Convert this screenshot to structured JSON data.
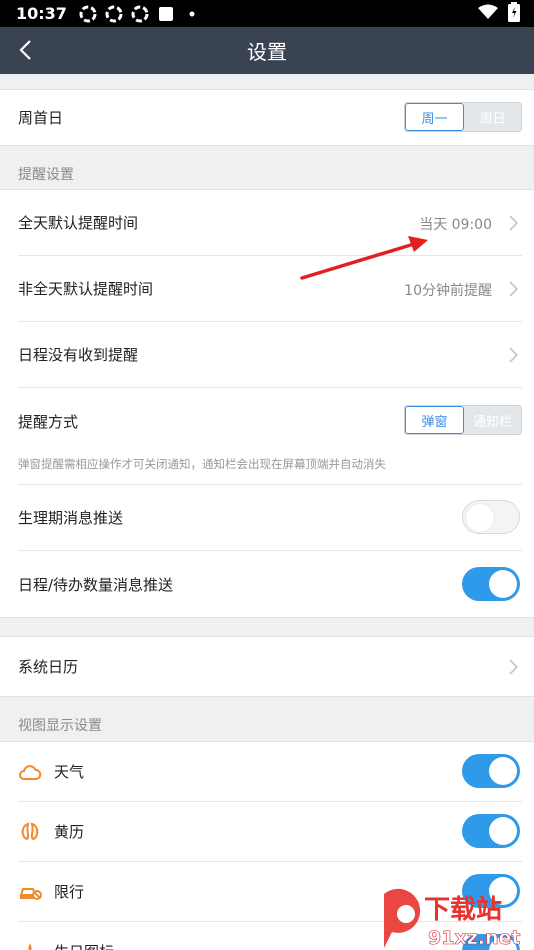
{
  "status_bar": {
    "time": "10:37"
  },
  "title_bar": {
    "title": "设置"
  },
  "week_start": {
    "label": "周首日",
    "options": [
      "周一",
      "周日"
    ],
    "selected": "周一"
  },
  "reminder_section": {
    "header": "提醒设置",
    "all_day_label": "全天默认提醒时间",
    "all_day_value": "当天 09:00",
    "non_all_day_label": "非全天默认提醒时间",
    "non_all_day_value": "10分钟前提醒",
    "not_received_label": "日程没有收到提醒",
    "method_label": "提醒方式",
    "method_options": [
      "弹窗",
      "通知栏"
    ],
    "method_selected": "弹窗",
    "method_note": "弹窗提醒需相应操作才可关闭通知，通知栏会出现在屏幕顶端并自动消失",
    "period_push_label": "生理期消息推送",
    "period_push_on": false,
    "count_push_label": "日程/待办数量消息推送",
    "count_push_on": true
  },
  "system_calendar": {
    "label": "系统日历"
  },
  "view_section": {
    "header": "视图显示设置",
    "items": [
      {
        "label": "天气",
        "icon": "cloud-icon",
        "on": true
      },
      {
        "label": "黄历",
        "icon": "almanac-icon",
        "on": true
      },
      {
        "label": "限行",
        "icon": "car-icon",
        "on": true
      },
      {
        "label": "生日图标",
        "icon": "birthday-icon",
        "on": true
      }
    ]
  },
  "colors": {
    "accent": "#2f9ae9",
    "titlebar": "#3a4352",
    "annotation_arrow": "#e02020",
    "icon_orange": "#f08a2c"
  },
  "watermark": {
    "text": "下载站",
    "site": "91xz.net"
  }
}
